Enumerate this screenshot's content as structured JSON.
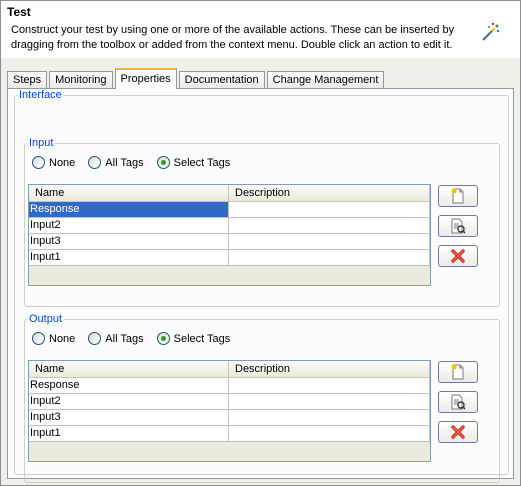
{
  "header": {
    "title": "Test",
    "description": "Construct your test by using one or more of the available actions.  These can be inserted by dragging from the toolbox or added from the context menu. Double click an action to edit it.",
    "icon": "magic-wand-icon"
  },
  "tabs": [
    {
      "label": "Steps"
    },
    {
      "label": "Monitoring"
    },
    {
      "label": "Properties",
      "active": true
    },
    {
      "label": "Documentation"
    },
    {
      "label": "Change Management"
    }
  ],
  "interface": {
    "legend": "Interface",
    "input": {
      "legend": "Input",
      "radios": [
        {
          "label": "None",
          "checked": false
        },
        {
          "label": "All Tags",
          "checked": false
        },
        {
          "label": "Select Tags",
          "checked": true
        }
      ],
      "columns": [
        "Name",
        "Description"
      ],
      "rows": [
        {
          "name": "Response",
          "description": "",
          "selected": true
        },
        {
          "name": "Input2",
          "description": ""
        },
        {
          "name": "Input3",
          "description": ""
        },
        {
          "name": "Input1",
          "description": ""
        }
      ],
      "buttons": [
        "new-tag-icon",
        "edit-tag-icon",
        "delete-icon"
      ]
    },
    "output": {
      "legend": "Output",
      "radios": [
        {
          "label": "None",
          "checked": false
        },
        {
          "label": "All Tags",
          "checked": false
        },
        {
          "label": "Select Tags",
          "checked": true
        }
      ],
      "columns": [
        "Name",
        "Description"
      ],
      "rows": [
        {
          "name": "Response",
          "description": ""
        },
        {
          "name": "Input2",
          "description": ""
        },
        {
          "name": "Input3",
          "description": ""
        },
        {
          "name": "Input1",
          "description": ""
        }
      ],
      "buttons": [
        "new-tag-icon",
        "edit-tag-icon",
        "delete-icon"
      ]
    }
  },
  "colors": {
    "accent_tab": "#f2b13c",
    "group_legend": "#0046d5",
    "selection": "#316ac5",
    "delete": "#d42b1e"
  }
}
